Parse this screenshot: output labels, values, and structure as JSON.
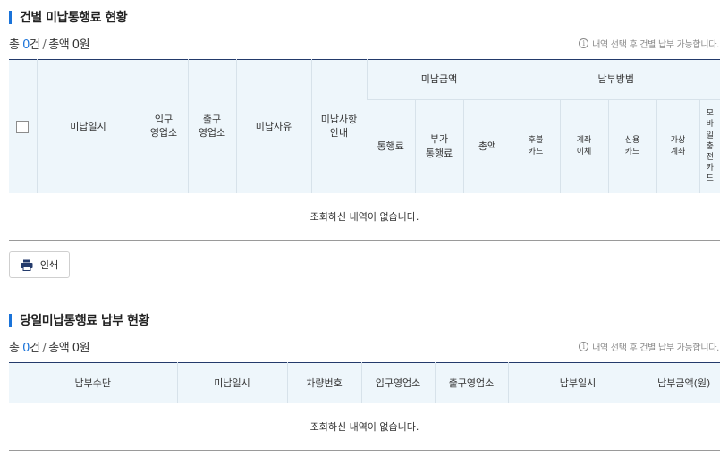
{
  "section1": {
    "title": "건별 미납통행료 현황",
    "summary": {
      "total_prefix": "총 ",
      "count": "0",
      "count_unit": "건",
      "separator": "/",
      "amount_prefix": "총액 ",
      "amount": "0원"
    },
    "hint": "내역 선택 후 건별 납부 가능합니다.",
    "headers": {
      "unpaid_datetime": "미납일시",
      "entry_office": "입구\n영업소",
      "exit_office": "출구\n영업소",
      "unpaid_reason": "미납사유",
      "unpaid_notice": "미납사항\n안내",
      "unpaid_amount_group": "미납금액",
      "toll": "통행료",
      "surcharge": "부가\n통행료",
      "total": "총액",
      "payment_method_group": "납부방법",
      "postpaid_card": "후불\n카드",
      "account_transfer": "계좌\n이체",
      "credit_card": "신용\n카드",
      "virtual_account": "가상\n계좌",
      "mobile_charge_card": "모\n바\n일\n충\n전\n카\n드"
    },
    "empty_message": "조회하신 내역이 없습니다.",
    "print_label": "인쇄"
  },
  "section2": {
    "title": "당일미납통행료 납부 현황",
    "summary": {
      "total_prefix": "총 ",
      "count": "0",
      "count_unit": "건",
      "separator": "/",
      "amount_prefix": "총액 ",
      "amount": "0원"
    },
    "hint": "내역 선택 후 건별 납부 가능합니다.",
    "headers": {
      "payment_means": "납부수단",
      "unpaid_datetime": "미납일시",
      "vehicle_number": "차량번호",
      "entry_office": "입구영업소",
      "exit_office": "출구영업소",
      "payment_datetime": "납부일시",
      "payment_amount": "납부금액(원)"
    },
    "empty_message": "조회하신 내역이 없습니다."
  },
  "colors": {
    "accent": "#1a73d9",
    "header_bg": "#eef6fb",
    "table_top_border": "#233a6b"
  },
  "icons": {
    "info": "info-icon",
    "print": "printer-icon"
  }
}
